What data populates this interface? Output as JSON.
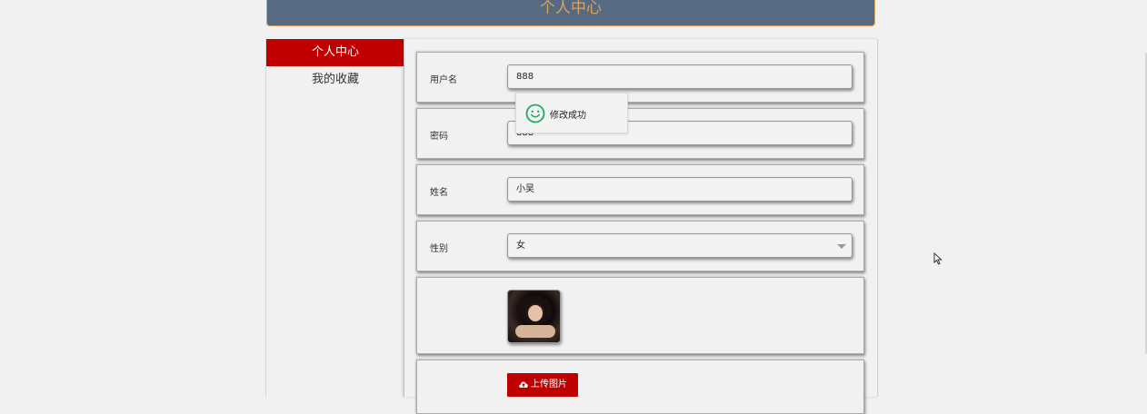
{
  "header": {
    "title": "个人中心"
  },
  "sidebar": {
    "items": [
      {
        "label": "个人中心",
        "active": true
      },
      {
        "label": "我的收藏",
        "active": false
      }
    ]
  },
  "form": {
    "username": {
      "label": "用户名",
      "value": "888"
    },
    "password": {
      "label": "密码",
      "value": "888"
    },
    "name": {
      "label": "姓名",
      "value": "小吴"
    },
    "gender": {
      "label": "性别",
      "value": "女"
    },
    "upload": {
      "label": "上传图片"
    }
  },
  "toast": {
    "message": "修改成功"
  },
  "colors": {
    "accent": "#c00000",
    "header_bg": "#566b82",
    "header_text": "#d9a35e",
    "success": "#1aad5b"
  },
  "icons": {
    "toast": "smile-icon",
    "upload": "cloud-upload-icon",
    "cursor": "mouse-pointer-icon"
  }
}
